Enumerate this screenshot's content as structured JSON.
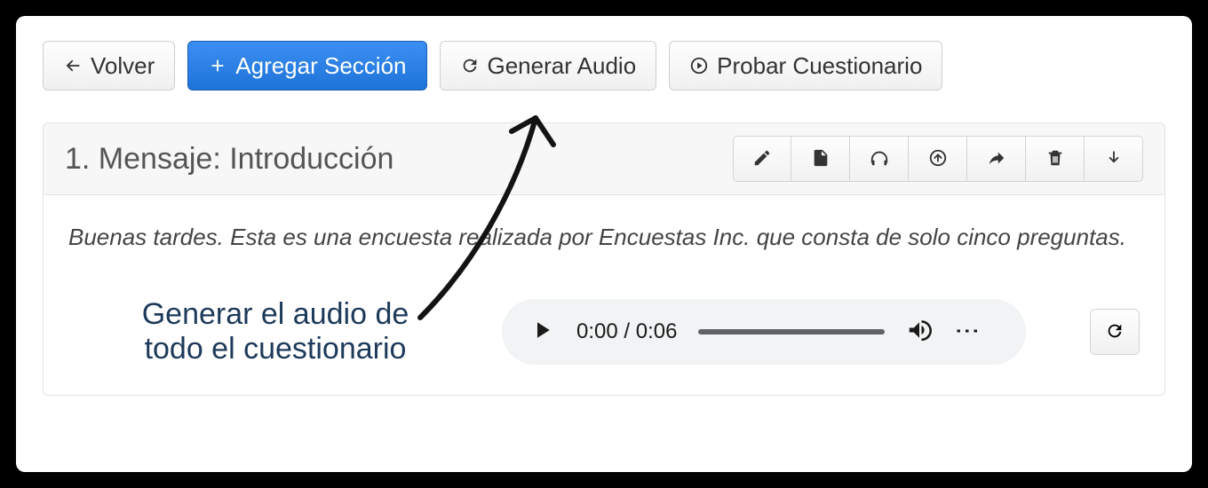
{
  "toolbar": {
    "back_label": "Volver",
    "add_section_label": "Agregar Sección",
    "generate_audio_label": "Generar Audio",
    "test_questionnaire_label": "Probar Cuestionario"
  },
  "section": {
    "title": "1. Mensaje: Introducción",
    "body": "Buenas tardes. Esta es una encuesta realizada por Encuestas Inc. que consta de solo cinco preguntas."
  },
  "audio": {
    "current": "0:00",
    "duration": "0:06"
  },
  "annotation": {
    "line1": "Generar el audio de",
    "line2": "todo el cuestionario"
  }
}
